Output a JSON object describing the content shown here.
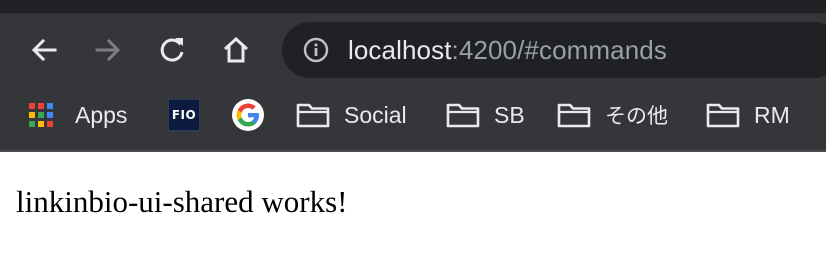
{
  "toolbar": {
    "back_icon": "arrow-left-icon",
    "forward_icon": "arrow-right-icon",
    "reload_icon": "reload-icon",
    "home_icon": "home-icon"
  },
  "omnibox": {
    "info_icon": "info-icon",
    "host": "localhost",
    "rest": ":4200/#commands"
  },
  "bookmarks": {
    "apps": "Apps",
    "fio": "FIO",
    "social": "Social",
    "sb": "SB",
    "other": "その他",
    "rm": "RM"
  },
  "page": {
    "text": "linkinbio-ui-shared works!"
  },
  "colors": {
    "toolbar_bg": "#35363a",
    "omnibox_bg": "#202124",
    "text_light": "#e8eaed",
    "text_dim": "#9aa0a6"
  }
}
